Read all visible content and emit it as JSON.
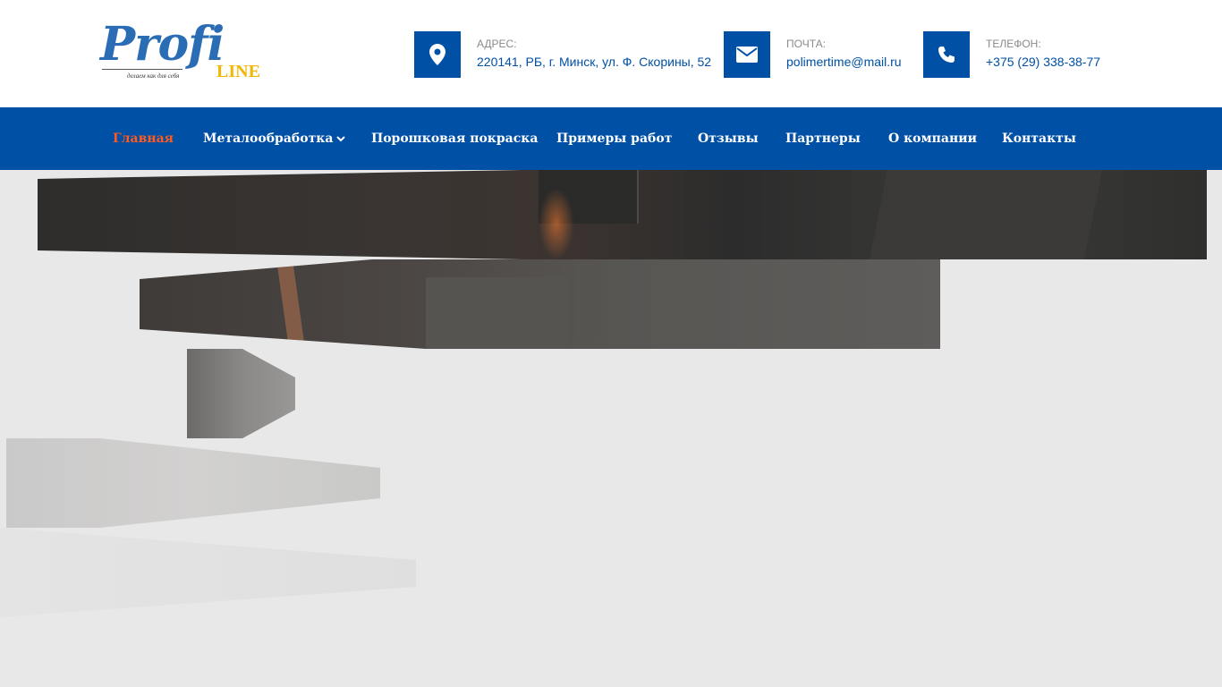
{
  "logo": {
    "name": "Profi",
    "suffix": "LINE",
    "tagline": "делаем как для себя"
  },
  "contacts": {
    "address": {
      "label": "Адрес:",
      "value": "220141, РБ, г. Минск, ул. Ф. Скорины, 52",
      "icon": "map-marker-icon"
    },
    "mail": {
      "label": "Почта:",
      "value": "polimertime@mail.ru",
      "icon": "envelope-icon"
    },
    "phone": {
      "label": "Телефон:",
      "value": "+375 (29) 338-38-77",
      "icon": "phone-icon"
    }
  },
  "nav": {
    "items": [
      {
        "label": "Главная",
        "active": true
      },
      {
        "label": "Металообработка",
        "has_dropdown": true
      },
      {
        "label": "Порошковая покраска"
      },
      {
        "label": "Примеры работ"
      },
      {
        "label": "Отзывы"
      },
      {
        "label": "Партнеры"
      },
      {
        "label": "О компании"
      },
      {
        "label": "Контакты"
      }
    ]
  },
  "colors": {
    "brand_blue": "#0050a5",
    "active_nav": "#ff5a1f",
    "logo_yellow": "#f2b705",
    "page_bg": "#e8e8e8"
  }
}
